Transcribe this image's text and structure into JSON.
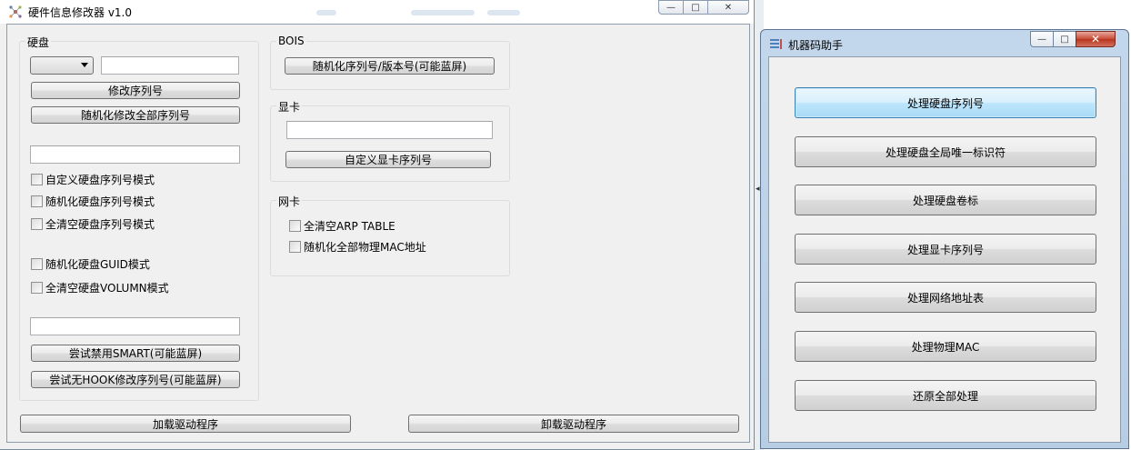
{
  "main_window": {
    "title": "硬件信息修改器 v1.0",
    "controls": {
      "minimize": "—",
      "maximize": "□",
      "close": "✕"
    },
    "disk_group": {
      "label": "硬盘",
      "combo_value": "",
      "serial_input": {
        "value": "",
        "placeholder": ""
      },
      "modify_serial_button": "修改序列号",
      "randomize_all_button": "随机化修改全部序列号",
      "second_input": {
        "value": "",
        "placeholder": ""
      },
      "checkboxes": [
        {
          "label": "自定义硬盘序列号模式",
          "checked": false
        },
        {
          "label": "随机化硬盘序列号模式",
          "checked": false
        },
        {
          "label": "全清空硬盘序列号模式",
          "checked": false
        },
        {
          "label": "随机化硬盘GUID模式",
          "checked": false
        },
        {
          "label": "全清空硬盘VOLUMN模式",
          "checked": false
        }
      ],
      "third_input": {
        "value": "",
        "placeholder": ""
      },
      "disable_smart_button": "尝试禁用SMART(可能蓝屏)",
      "nohook_button": "尝试无HOOK修改序列号(可能蓝屏)"
    },
    "bios_group": {
      "label": "BOIS",
      "randomize_button": "随机化序列号/版本号(可能蓝屏)"
    },
    "gpu_group": {
      "label": "显卡",
      "gpu_input": {
        "value": "",
        "placeholder": ""
      },
      "custom_button": "自定义显卡序列号"
    },
    "nic_group": {
      "label": "网卡",
      "checkboxes": [
        {
          "label": "全清空ARP TABLE",
          "checked": false
        },
        {
          "label": "随机化全部物理MAC地址",
          "checked": false
        }
      ]
    },
    "load_driver_button": "加载驱动程序",
    "unload_driver_button": "卸载驱动程序"
  },
  "helper_window": {
    "title": "机器码助手",
    "controls": {
      "minimize": "—",
      "maximize": "□",
      "close": "✕"
    },
    "buttons": [
      "处理硬盘序列号",
      "处理硬盘全局唯一标识符",
      "处理硬盘卷标",
      "处理显卡序列号",
      "处理网络地址表",
      "处理物理MAC",
      "还原全部处理"
    ]
  },
  "colors": {
    "window_face": "#f0f0f0",
    "aero_frame": "#c3d7ec",
    "focus_button": "#bee6fd",
    "close_red": "#c74b35"
  }
}
